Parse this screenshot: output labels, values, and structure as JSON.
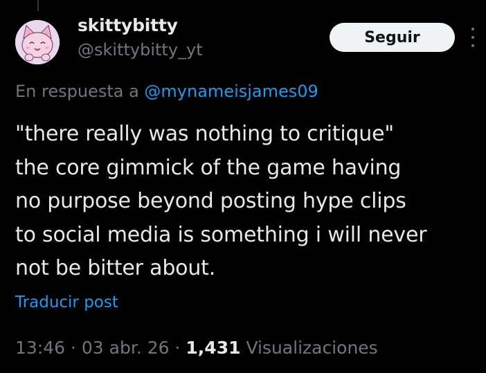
{
  "author": {
    "display_name": "skittybitty",
    "handle": "@skittybitty_yt"
  },
  "follow_label": "Seguir",
  "more_icon": "more-vertical-icon",
  "reply": {
    "prefix": "En respuesta a",
    "mention": "@mynameisjames09"
  },
  "tweet": {
    "lines": [
      "\"there really was nothing to critique\"",
      "the core gimmick of the game having",
      "no purpose beyond posting hype clips",
      "to social media is something i will never",
      "not be bitter about."
    ]
  },
  "translate_label": "Traducir post",
  "meta": {
    "time": "13:46",
    "sep1": "·",
    "date": "03 abr. 26",
    "sep2": "·",
    "views_count": "1,431",
    "views_label": "Visualizaciones"
  },
  "colors": {
    "background": "#000000",
    "text": "#e7e9ea",
    "secondary": "#71767b",
    "link": "#1d9bf0",
    "button_bg": "#eff3f4"
  }
}
